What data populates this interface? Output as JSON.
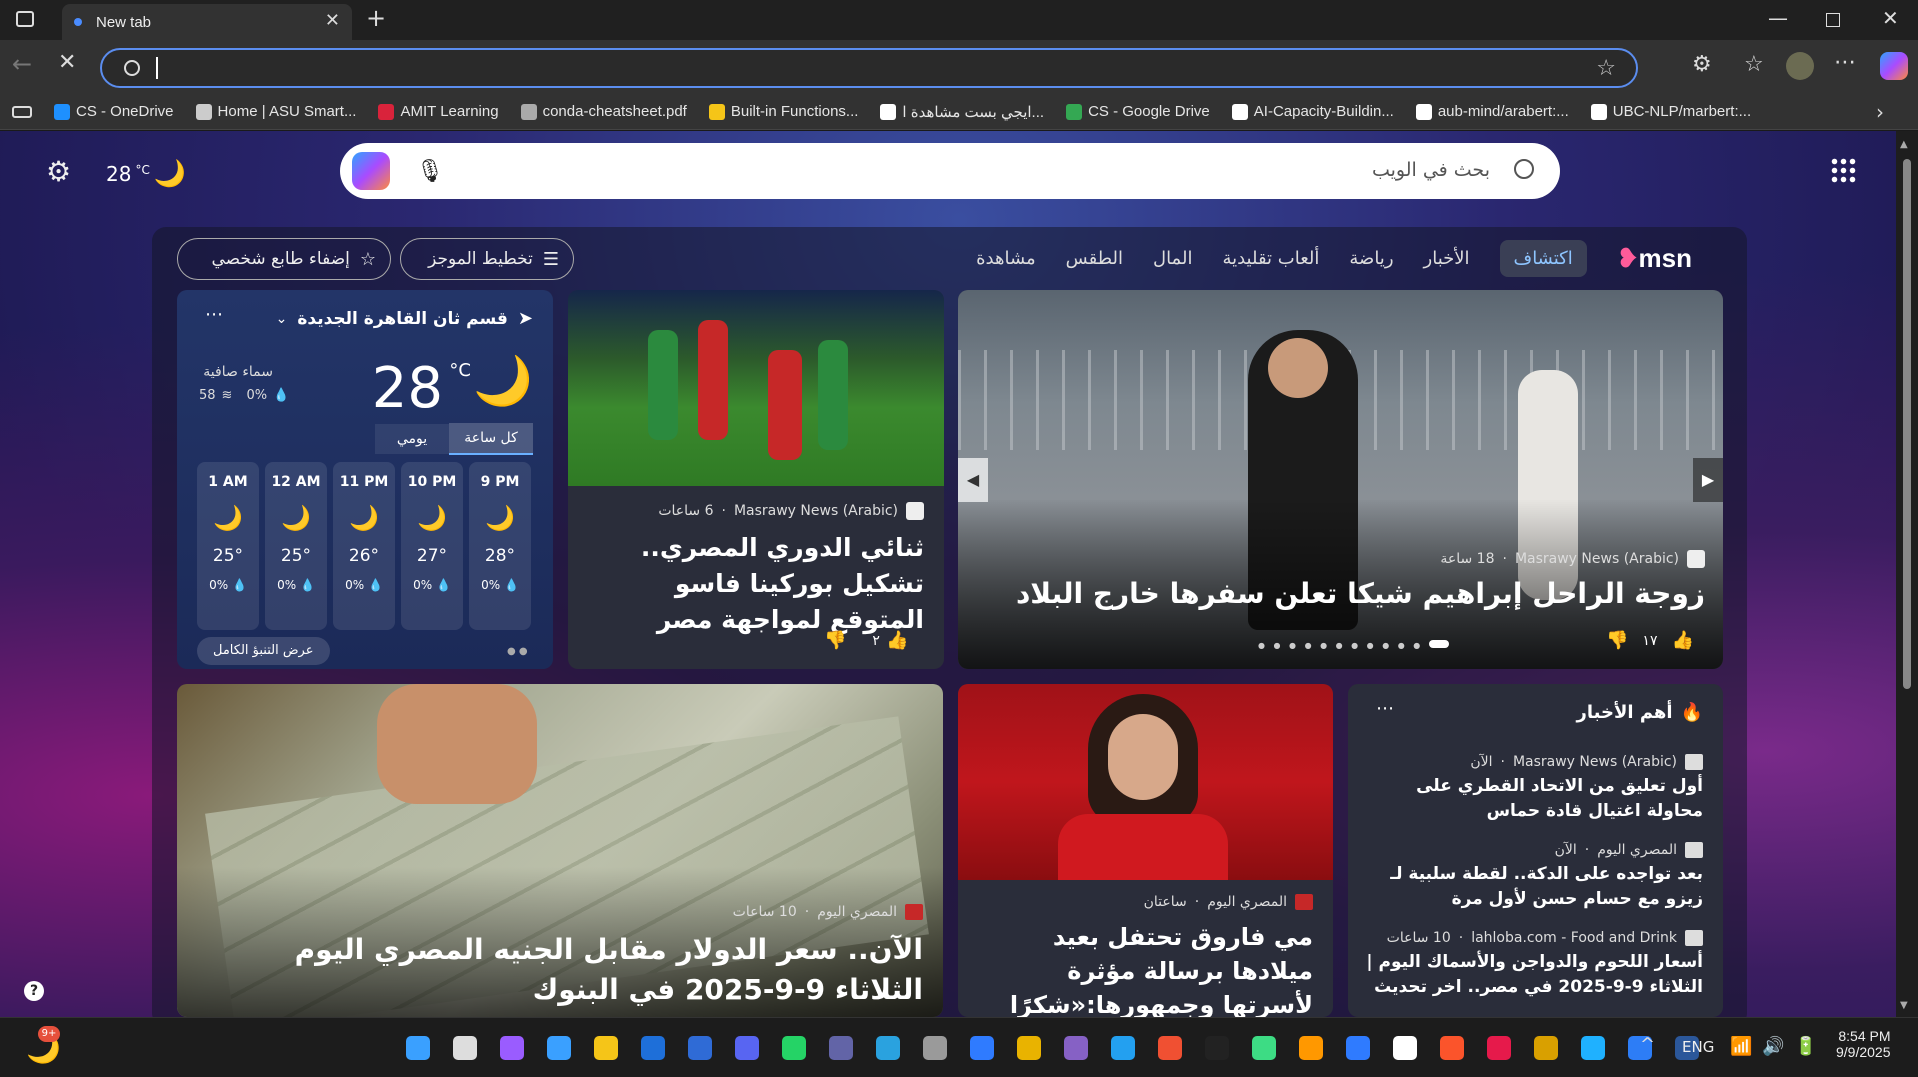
{
  "browser": {
    "tab_title": "New tab",
    "address_value": "",
    "bookmarks": [
      {
        "label": "CS - OneDrive",
        "icon": "onedrive-icon",
        "color": "#1e90ff"
      },
      {
        "label": "Home | ASU Smart...",
        "icon": "asu-icon",
        "color": "#cccccc"
      },
      {
        "label": "AMIT Learning",
        "icon": "amit-icon",
        "color": "#d9233b"
      },
      {
        "label": "conda-cheatsheet.pdf",
        "icon": "pdf-icon",
        "color": "#aaaaaa"
      },
      {
        "label": "Built-in Functions...",
        "icon": "python-icon",
        "color": "#f5c518"
      },
      {
        "label": "ايجي بست مشاهدة ا...",
        "icon": "egybest-icon",
        "color": "#ffffff"
      },
      {
        "label": "CS - Google Drive",
        "icon": "drive-icon",
        "color": "#34a853"
      },
      {
        "label": "AI-Capacity-Buildin...",
        "icon": "github-icon",
        "color": "#ffffff"
      },
      {
        "label": "aub-mind/arabert:...",
        "icon": "github-icon",
        "color": "#ffffff"
      },
      {
        "label": "UBC-NLP/marbert:...",
        "icon": "github-icon",
        "color": "#ffffff"
      }
    ]
  },
  "top": {
    "temp": "28",
    "unit": "°C",
    "search_placeholder": "بحث في الويب"
  },
  "feed": {
    "logo": "msn",
    "nav_items": [
      "اكتشاف",
      "الأخبار",
      "رياضة",
      "ألعاب تقليدية",
      "المال",
      "الطقس",
      "مشاهدة"
    ],
    "active_nav": "اكتشاف",
    "layout_button": "تخطيط الموجز",
    "personalize_button": "إضفاء طابع شخصي"
  },
  "weather": {
    "location": "قسم ثان القاهرة الجديدة",
    "temp": "28",
    "unit": "°C",
    "condition": "سماء صافية",
    "wind": "58",
    "humidity": "0%",
    "precip": "0%",
    "tab_hourly": "كل ساعة",
    "tab_daily": "يومي",
    "hours": [
      {
        "time": "9 PM",
        "temp": "28°",
        "rain": "0%"
      },
      {
        "time": "10 PM",
        "temp": "27°",
        "rain": "0%"
      },
      {
        "time": "11 PM",
        "temp": "26°",
        "rain": "0%"
      },
      {
        "time": "12 AM",
        "temp": "25°",
        "rain": "0%"
      },
      {
        "time": "1 AM",
        "temp": "25°",
        "rain": "0%"
      }
    ],
    "full_forecast": "عرض التنبؤ الكامل"
  },
  "hero": {
    "source": "Masrawy News (Arabic)",
    "age": "18 ساعة",
    "title": "زوجة الراحل إبراهيم شيكا تعلن سفرها خارج البلاد",
    "likes": "١٧"
  },
  "sports": {
    "source": "Masrawy News (Arabic)",
    "age": "6 ساعات",
    "title": "ثنائي الدوري المصري.. تشكيل بوركينا فاسو المتوقع لمواجهة مصر",
    "likes": "٢"
  },
  "top_news": {
    "header": "أهم الأخبار",
    "items": [
      {
        "source": "Masrawy News (Arabic)",
        "age": "الآن",
        "title": "أول تعليق من الاتحاد القطري على محاولة اغتيال قادة حماس"
      },
      {
        "source": "المصري اليوم",
        "age": "الآن",
        "title": "بعد تواجده على الدكة.. لقطة سلبية لـ زيزو مع حسام حسن لأول مرة"
      },
      {
        "source": "lahloba.com - Food and Drink",
        "age": "10 ساعات",
        "title": "أسعار اللحوم والدواجن والأسماك اليوم | الثلاثاء 9-9-2025 في مصر.. اخر تحديث"
      }
    ]
  },
  "celeb": {
    "source": "المصري اليوم",
    "age": "ساعتان",
    "title": "مي فاروق تحتفل بعيد ميلادها برسالة مؤثرة لأسرتها وجمهورها:«شكرًا لنفسي لأنها..."
  },
  "money": {
    "source": "المصري اليوم",
    "age": "10 ساعات",
    "title": "الآن.. سعر الدولار مقابل الجنيه المصري اليوم الثلاثاء 9-9-2025 في البنوك"
  },
  "taskbar": {
    "badge": "9+",
    "lang": "ENG",
    "time": "8:54 PM",
    "date": "9/9/2025"
  }
}
